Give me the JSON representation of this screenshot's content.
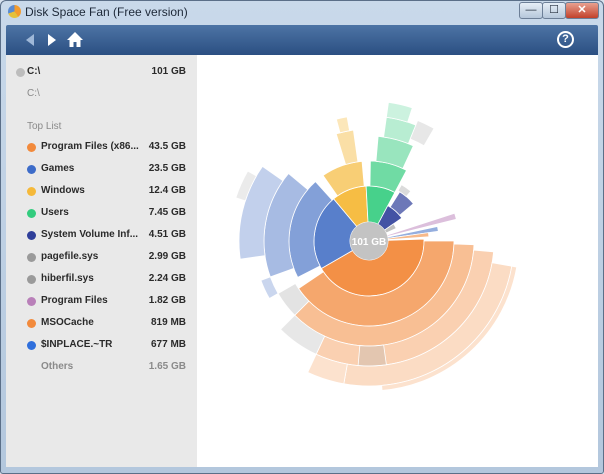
{
  "window": {
    "title": "Disk Space Fan (Free version)",
    "buttons": {
      "minimize": "—",
      "maximize": "☐",
      "close": "✕"
    }
  },
  "toolbar": {
    "help": "?"
  },
  "drive": {
    "name": "C:\\",
    "size": "101 GB",
    "path": "C:\\"
  },
  "toplist": {
    "heading": "Top List",
    "items": [
      {
        "name": "Program Files (x86...",
        "size": "43.5 GB",
        "color": "#f28a3c"
      },
      {
        "name": "Games",
        "size": "23.5 GB",
        "color": "#3d6cc9"
      },
      {
        "name": "Windows",
        "size": "12.4 GB",
        "color": "#f5b93a"
      },
      {
        "name": "Users",
        "size": "7.45 GB",
        "color": "#33cc7e"
      },
      {
        "name": "System Volume Inf...",
        "size": "4.51 GB",
        "color": "#2f3f9a"
      },
      {
        "name": "pagefile.sys",
        "size": "2.99 GB",
        "color": "#9a9a9a"
      },
      {
        "name": "hiberfil.sys",
        "size": "2.24 GB",
        "color": "#9a9a9a"
      },
      {
        "name": "Program Files",
        "size": "1.82 GB",
        "color": "#b980b9"
      },
      {
        "name": "MSOCache",
        "size": "819 MB",
        "color": "#f28a3c"
      },
      {
        "name": "$INPLACE.~TR",
        "size": "677 MB",
        "color": "#2f6fdc"
      }
    ],
    "others": {
      "name": "Others",
      "size": "1.65 GB"
    }
  },
  "chart": {
    "center_label": "101 GB"
  }
}
